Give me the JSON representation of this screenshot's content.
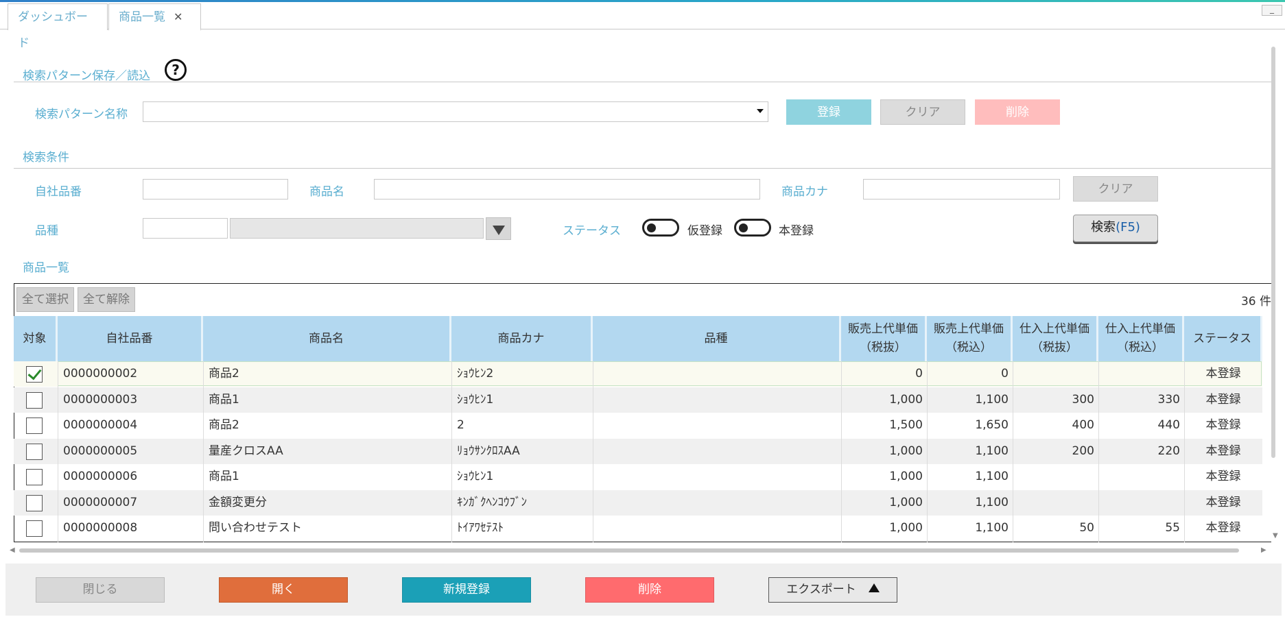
{
  "tabs": [
    {
      "label": "ダッシュボード"
    },
    {
      "label": "商品一覧",
      "close": "✕"
    }
  ],
  "window": {
    "minimize": "_"
  },
  "pattern_section": {
    "title": "検索パターン保存／読込",
    "help": "?",
    "name_label": "検索パターン名称",
    "name_value": "",
    "register": "登録",
    "clear": "クリア",
    "delete": "削除"
  },
  "condition_section": {
    "title": "検索条件",
    "own_code_label": "自社品番",
    "own_code_value": "",
    "product_name_label": "商品名",
    "product_name_value": "",
    "product_kana_label": "商品カナ",
    "product_kana_value": "",
    "clear": "クリア",
    "variety_label": "品種",
    "variety_code_value": "",
    "variety_name_value": "",
    "status_label": "ステータス",
    "status_temp": "仮登録",
    "status_final": "本登録",
    "search": "検索",
    "search_key": "(F5)"
  },
  "list_section": {
    "title": "商品一覧",
    "select_all": "全て選択",
    "deselect_all": "全て解除",
    "count": "36 件",
    "columns": [
      {
        "l1": "対象",
        "l2": ""
      },
      {
        "l1": "自社品番",
        "l2": ""
      },
      {
        "l1": "商品名",
        "l2": ""
      },
      {
        "l1": "商品カナ",
        "l2": ""
      },
      {
        "l1": "品種",
        "l2": ""
      },
      {
        "l1": "販売上代単価",
        "l2": "（税抜）"
      },
      {
        "l1": "販売上代単価",
        "l2": "（税込）"
      },
      {
        "l1": "仕入上代単価",
        "l2": "（税抜）"
      },
      {
        "l1": "仕入上代単価",
        "l2": "（税込）"
      },
      {
        "l1": "ステータス",
        "l2": ""
      }
    ],
    "rows": [
      {
        "checked": true,
        "code": "0000000002",
        "name": "商品2",
        "kana": "ｼｮｳﾋﾝ2",
        "variety": "",
        "sell_ex": "0",
        "sell_in": "0",
        "buy_ex": "",
        "buy_in": "",
        "status": "本登録"
      },
      {
        "checked": false,
        "code": "0000000003",
        "name": "商品1",
        "kana": "ｼｮｳﾋﾝ1",
        "variety": "",
        "sell_ex": "1,000",
        "sell_in": "1,100",
        "buy_ex": "300",
        "buy_in": "330",
        "status": "本登録"
      },
      {
        "checked": false,
        "code": "0000000004",
        "name": "商品2",
        "kana": "2",
        "variety": "",
        "sell_ex": "1,500",
        "sell_in": "1,650",
        "buy_ex": "400",
        "buy_in": "440",
        "status": "本登録"
      },
      {
        "checked": false,
        "code": "0000000005",
        "name": "量産クロスAA",
        "kana": "ﾘｮｳｻﾝｸﾛｽAA",
        "variety": "",
        "sell_ex": "1,000",
        "sell_in": "1,100",
        "buy_ex": "200",
        "buy_in": "220",
        "status": "本登録"
      },
      {
        "checked": false,
        "code": "0000000006",
        "name": "商品1",
        "kana": "ｼｮｳﾋﾝ1",
        "variety": "",
        "sell_ex": "1,000",
        "sell_in": "1,100",
        "buy_ex": "",
        "buy_in": "",
        "status": "本登録"
      },
      {
        "checked": false,
        "code": "0000000007",
        "name": "金額変更分",
        "kana": "ｷﾝｶﾞｸﾍﾝｺｳﾌﾞﾝ",
        "variety": "",
        "sell_ex": "1,000",
        "sell_in": "1,100",
        "buy_ex": "",
        "buy_in": "",
        "status": "本登録"
      },
      {
        "checked": false,
        "code": "0000000008",
        "name": "問い合わせテスト",
        "kana": "ﾄｲｱﾜｾﾃｽﾄ",
        "variety": "",
        "sell_ex": "1,000",
        "sell_in": "1,100",
        "buy_ex": "50",
        "buy_in": "55",
        "status": "本登録"
      }
    ]
  },
  "footer": {
    "close": "閉じる",
    "open": "開く",
    "new": "新規登録",
    "delete": "削除",
    "export": "エクスポート"
  }
}
